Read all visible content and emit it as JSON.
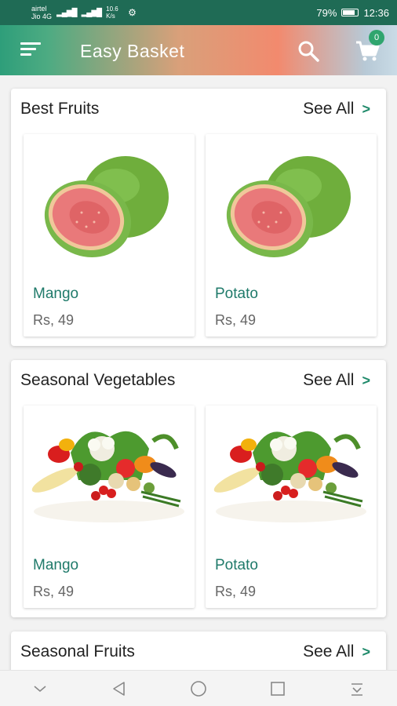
{
  "status_bar": {
    "carrier1": "airtel",
    "carrier2": "Jio 4G",
    "data_speed": "10.6 K/s",
    "battery": "79%",
    "time": "12:36"
  },
  "app_bar": {
    "title": "Easy Basket",
    "cart_count": "0"
  },
  "sections": [
    {
      "title": "Best Fruits",
      "see_all": "See All",
      "items": [
        {
          "name": "Mango",
          "price": "Rs, 49",
          "image": "guava"
        },
        {
          "name": "Potato",
          "price": "Rs, 49",
          "image": "guava"
        }
      ]
    },
    {
      "title": "Seasonal Vegetables",
      "see_all": "See All",
      "items": [
        {
          "name": "Mango",
          "price": "Rs, 49",
          "image": "vegetables"
        },
        {
          "name": "Potato",
          "price": "Rs, 49",
          "image": "vegetables"
        }
      ]
    },
    {
      "title": "Seasonal Fruits",
      "see_all": "See All",
      "items": []
    }
  ],
  "colors": {
    "status_bar": "#1f6b55",
    "accent": "#1f7a6a",
    "badge": "#2fa56e"
  }
}
